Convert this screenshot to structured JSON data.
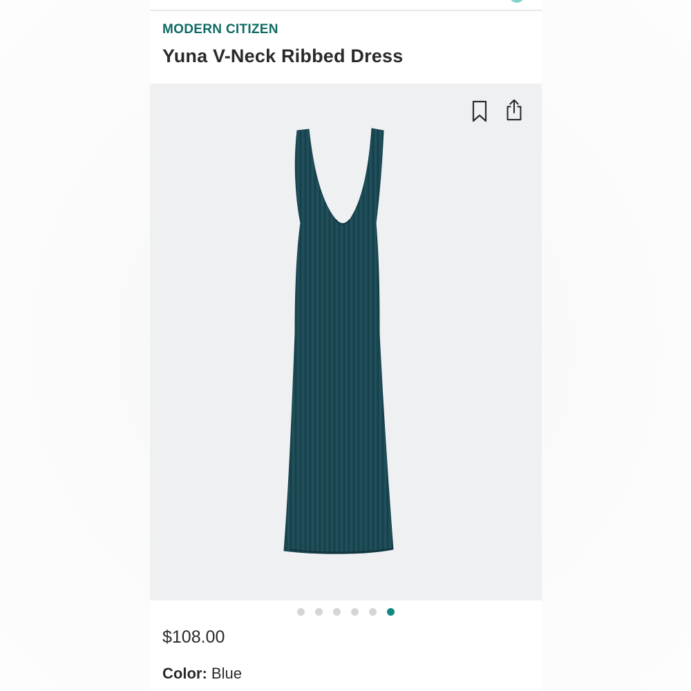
{
  "product": {
    "brand": "MODERN CITIZEN",
    "title": "Yuna V-Neck Ribbed Dress",
    "price": "$108.00",
    "color_label": "Color:",
    "color_value": "Blue"
  },
  "actions": {
    "bookmark_icon": "bookmark-icon",
    "share_icon": "share-icon"
  },
  "carousel": {
    "total": 6,
    "active_index": 5
  },
  "colors": {
    "brand": "#0e6b63",
    "accent": "#118781",
    "dress": "#1c4a55",
    "image_bg": "#eff0f2"
  }
}
